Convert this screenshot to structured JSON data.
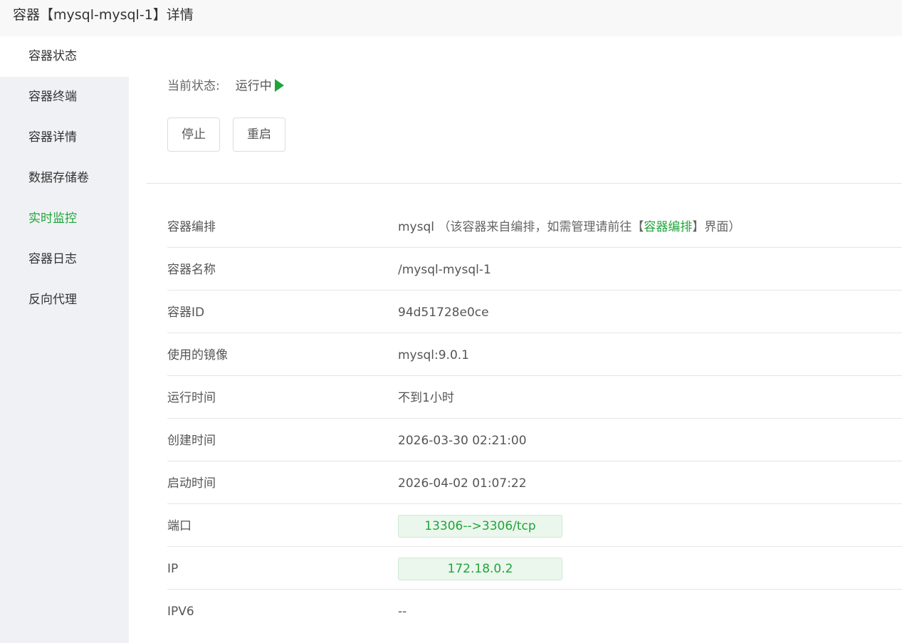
{
  "header": {
    "title": "容器【mysql-mysql-1】详情"
  },
  "sidebar": {
    "items": [
      {
        "label": "容器状态"
      },
      {
        "label": "容器终端"
      },
      {
        "label": "容器详情"
      },
      {
        "label": "数据存储卷"
      },
      {
        "label": "实时监控"
      },
      {
        "label": "容器日志"
      },
      {
        "label": "反向代理"
      }
    ]
  },
  "status": {
    "label": "当前状态:",
    "value": "运行中",
    "icon": "play-icon",
    "color": "#20a53a"
  },
  "actions": {
    "stop_label": "停止",
    "restart_label": "重启"
  },
  "details": {
    "compose": {
      "label": "容器编排",
      "value": "mysql",
      "note_prefix": "（该容器来自编排，如需管理请前往【",
      "note_link": "容器编排",
      "note_suffix": "】界面）"
    },
    "name": {
      "label": "容器名称",
      "value": "/mysql-mysql-1"
    },
    "id": {
      "label": "容器ID",
      "value": "94d51728e0ce"
    },
    "image": {
      "label": "使用的镜像",
      "value": "mysql:9.0.1"
    },
    "uptime": {
      "label": "运行时间",
      "value": "不到1小时"
    },
    "created": {
      "label": "创建时间",
      "value": "2026-03-30 02:21:00"
    },
    "started": {
      "label": "启动时间",
      "value": "2026-04-02 01:07:22"
    },
    "port": {
      "label": "端口",
      "value": "13306-->3306/tcp"
    },
    "ip": {
      "label": "IP",
      "value": "172.18.0.2"
    },
    "ipv6": {
      "label": "IPV6",
      "value": "--"
    }
  }
}
